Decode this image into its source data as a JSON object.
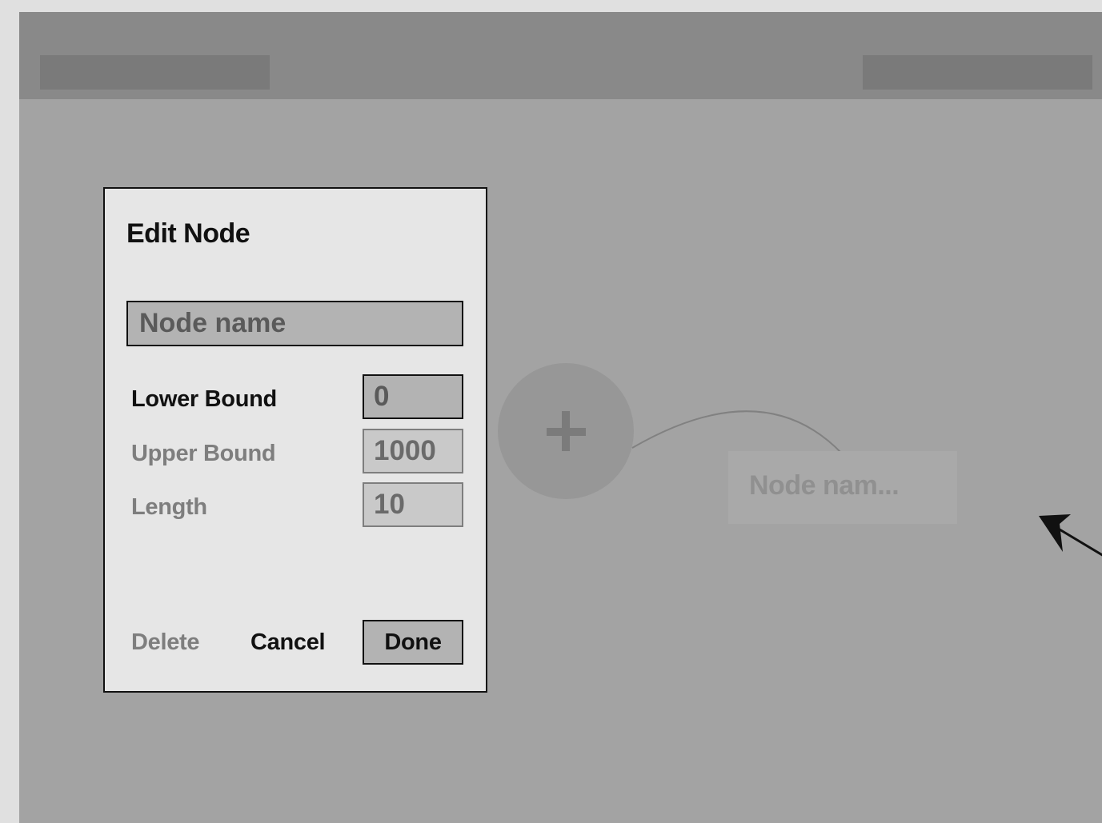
{
  "canvas": {
    "node_placeholder_label": "Node nam...",
    "add_node_icon": "plus-icon",
    "cursor_icon": "arrow-cursor-icon"
  },
  "dialog": {
    "title": "Edit Node",
    "name_placeholder": "Node name",
    "fields": {
      "lower_bound": {
        "label": "Lower Bound",
        "value": "0"
      },
      "upper_bound": {
        "label": "Upper Bound",
        "value": "1000"
      },
      "length": {
        "label": "Length",
        "value": "10"
      }
    },
    "buttons": {
      "delete": "Delete",
      "cancel": "Cancel",
      "done": "Done"
    }
  },
  "colors": {
    "background": "#a3a3a3",
    "topbar": "#898989",
    "dialog": "#e6e6e6"
  }
}
